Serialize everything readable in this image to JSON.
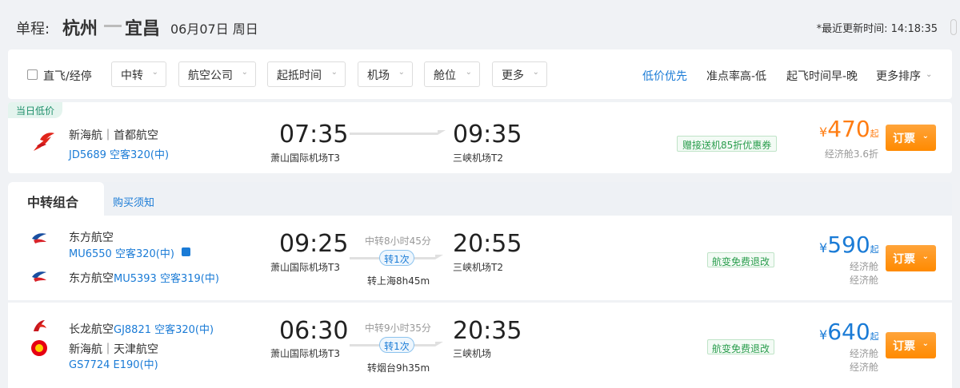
{
  "header": {
    "trip_label": "单程:",
    "from_city": "杭州",
    "to_city": "宜昌",
    "date": "06月07日 周日",
    "update_text": "*最近更新时间: 14:18:35"
  },
  "filters": {
    "direct_label": "直飞/经停",
    "dropdowns": [
      "中转",
      "航空公司",
      "起抵时间",
      "机场",
      "舱位",
      "更多"
    ],
    "sorts": [
      "低价优先",
      "准点率高-低",
      "起飞时间早-晚",
      "更多排序"
    ]
  },
  "lowest": {
    "tag": "当日低价",
    "airline": "新海航｜首都航空",
    "flight": "JD5689 空客320(中)",
    "dep_time": "07:35",
    "dep_airport": "萧山国际机场T3",
    "arr_time": "09:35",
    "arr_airport": "三峡机场T2",
    "promo": "赠接送机85折优惠券",
    "yen": "¥",
    "price": "470",
    "qi": "起",
    "cabin": "经济舱3.6折",
    "book": "订票"
  },
  "transfer_tabs": {
    "active": "中转组合",
    "link": "购买须知"
  },
  "transfers": [
    {
      "airline1": "东方航空",
      "flight1": "MU6550 空客320(中)",
      "airline2": "东方航空",
      "flight2": "MU5393 空客319(中)",
      "dep_time": "09:25",
      "dep_airport": "萧山国际机场T3",
      "trans_top": "中转8小时45分",
      "trans_pill": "转1次",
      "trans_bottom": "转上海8h45m",
      "arr_time": "20:55",
      "arr_airport": "三峡机场T2",
      "refund": "航变免费退改",
      "yen": "¥",
      "price": "590",
      "qi": "起",
      "cabin1": "经济舱",
      "cabin2": "经济舱",
      "book": "订票"
    },
    {
      "airline1": "长龙航空",
      "flight1": "GJ8821 空客320(中)",
      "airline2": "新海航｜天津航空",
      "flight2": "GS7724 E190(中)",
      "dep_time": "06:30",
      "dep_airport": "萧山国际机场T3",
      "trans_top": "中转9小时35分",
      "trans_pill": "转1次",
      "trans_bottom": "转烟台9h35m",
      "arr_time": "20:35",
      "arr_airport": "三峡机场",
      "refund": "航变免费退改",
      "yen": "¥",
      "price": "640",
      "qi": "起",
      "cabin1": "经济舱",
      "cabin2": "经济舱",
      "book": "订票"
    }
  ],
  "colors": {
    "accent_blue": "#1a7bd6",
    "price_orange": "#ff7d13",
    "promo_green": "#2a9d4d",
    "book_button": "#ff8a00"
  },
  "icons": [
    "hainan-airlines-logo-icon",
    "china-eastern-logo-icon",
    "loong-air-logo-icon",
    "tianjin-airlines-logo-icon",
    "chevron-down-icon",
    "video-icon"
  ]
}
